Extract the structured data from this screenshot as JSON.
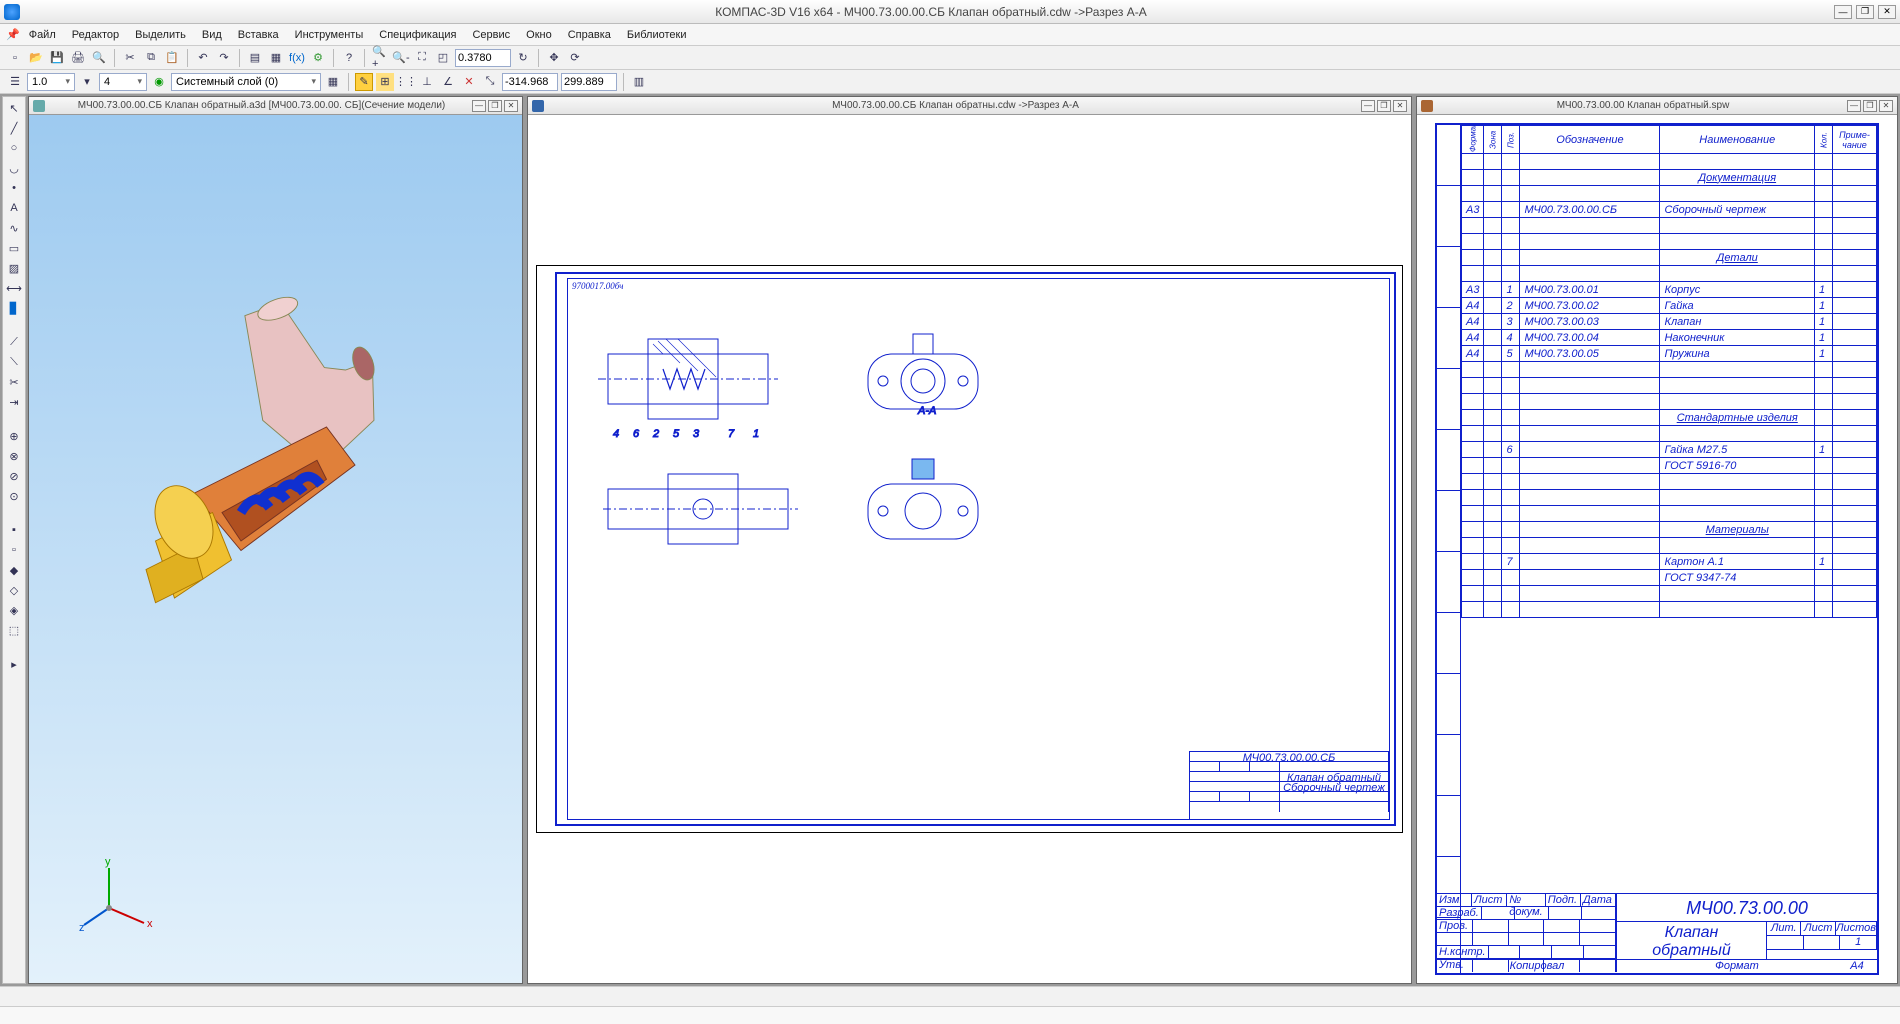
{
  "app": {
    "title": "КОМПАС-3D V16  x64 - МЧ00.73.00.00.СБ Клапан обратный.cdw ->Разрез А-А"
  },
  "menu": [
    "Файл",
    "Редактор",
    "Выделить",
    "Вид",
    "Вставка",
    "Инструменты",
    "Спецификация",
    "Сервис",
    "Окно",
    "Справка",
    "Библиотеки"
  ],
  "tb1": {
    "zoom": "0.3780"
  },
  "tb2": {
    "lw": "1.0",
    "layernum": "4",
    "layer": "Системный слой (0)",
    "cx": "-314.968",
    "cy": "299.889"
  },
  "panels": {
    "p1": "МЧ00.73.00.00.СБ Клапан обратный.a3d [МЧ00.73.00.00. СБ](Сечение модели)",
    "p2": "МЧ00.73.00.00.СБ Клапан обратны.cdw ->Разрез А-А",
    "p3": "МЧ00.73.00.00 Клапан  обратный.spw"
  },
  "drawing": {
    "code": "МЧ00.73.00.00.СБ",
    "name1": "Клапан обратный",
    "name2": "Сборочный чертеж",
    "sect": "А-А",
    "top_note": "9700017.00бч"
  },
  "spec": {
    "headers": {
      "format": "Формат",
      "zone": "Зона",
      "pos": "Поз.",
      "designation": "Обозначение",
      "name": "Наименование",
      "qty": "Кол.",
      "note": "Приме-\nчание"
    },
    "sections": {
      "doc": "Документация",
      "det": "Детали",
      "std": "Стандартные изделия",
      "mat": "Материалы"
    },
    "rows_doc": [
      {
        "f": "А3",
        "z": "",
        "p": "",
        "d": "МЧ00.73.00.00.СБ",
        "n": "Сборочный чертеж",
        "q": "",
        "note": ""
      }
    ],
    "rows_det": [
      {
        "f": "А3",
        "z": "",
        "p": "1",
        "d": "МЧ00.73.00.01",
        "n": "Корпус",
        "q": "1",
        "note": ""
      },
      {
        "f": "А4",
        "z": "",
        "p": "2",
        "d": "МЧ00.73.00.02",
        "n": "Гайка",
        "q": "1",
        "note": ""
      },
      {
        "f": "А4",
        "z": "",
        "p": "3",
        "d": "МЧ00.73.00.03",
        "n": "Клапан",
        "q": "1",
        "note": ""
      },
      {
        "f": "А4",
        "z": "",
        "p": "4",
        "d": "МЧ00.73.00.04",
        "n": "Наконечник",
        "q": "1",
        "note": ""
      },
      {
        "f": "А4",
        "z": "",
        "p": "5",
        "d": "МЧ00.73.00.05",
        "n": "Пружина",
        "q": "1",
        "note": ""
      }
    ],
    "rows_std": [
      {
        "f": "",
        "z": "",
        "p": "6",
        "d": "",
        "n": "Гайка М27.5",
        "q": "1",
        "note": ""
      },
      {
        "f": "",
        "z": "",
        "p": "",
        "d": "",
        "n": "ГОСТ 5916-70",
        "q": "",
        "note": ""
      }
    ],
    "rows_mat": [
      {
        "f": "",
        "z": "",
        "p": "7",
        "d": "",
        "n": "Картон А.1",
        "q": "1",
        "note": ""
      },
      {
        "f": "",
        "z": "",
        "p": "",
        "d": "",
        "n": "ГОСТ 9347-74",
        "q": "",
        "note": ""
      }
    ],
    "foot": {
      "code": "МЧ00.73.00.00",
      "name": "Клапан\nобратный",
      "labels": {
        "izm": "Изм.",
        "list": "Лист",
        "ndok": "№ докум.",
        "podp": "Подп.",
        "data": "Дата",
        "razrab": "Разраб.",
        "prov": "Пров.",
        "nkontr": "Н.контр.",
        "utv": "Утв.",
        "kopiroval": "Копировал",
        "format": "Формат",
        "a4": "А4",
        "lit": "Лит.",
        "listL": "Лист",
        "listov": "Листов",
        "one": "1"
      }
    }
  }
}
